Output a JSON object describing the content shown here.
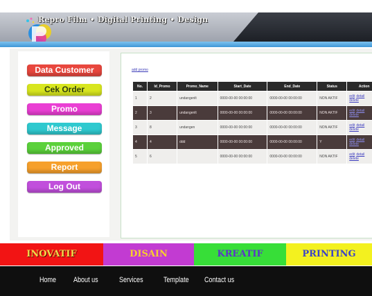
{
  "header": {
    "title": "Repro Film • Digital Printing • Design"
  },
  "sidebar": {
    "items": [
      {
        "label": "Data Customer"
      },
      {
        "label": "Cek Order"
      },
      {
        "label": "Promo"
      },
      {
        "label": "Message"
      },
      {
        "label": "Approved"
      },
      {
        "label": "Report"
      },
      {
        "label": "Log Out"
      }
    ]
  },
  "main": {
    "add_link": "add promo",
    "table": {
      "headers": [
        "No.",
        "Id_Promo",
        "Promo_Name",
        "Start_Date",
        "End_Date",
        "Status",
        "Action"
      ],
      "rows": [
        {
          "no": "1",
          "id": "2",
          "name": "undangenlt",
          "start": "0000-00-00 00:00:00",
          "end": "0000-00-00 00:00:00",
          "status": "NON AKTIF",
          "edit": "edit",
          "detail": "detail",
          "delete": "delete"
        },
        {
          "no": "2",
          "id": "3",
          "name": "undangenlt",
          "start": "0000-00-00 00:00:00",
          "end": "0000-00-00 00:00:00",
          "status": "NON AKTIF",
          "edit": "edit",
          "detail": "detail",
          "delete": "delete"
        },
        {
          "no": "3",
          "id": "8",
          "name": "undangen",
          "start": "0000-00-00 00:00:00",
          "end": "0000-00-00 00:00:00",
          "status": "NON AKTIF",
          "edit": "edit",
          "detail": "detail",
          "delete": "delete"
        },
        {
          "no": "4",
          "id": "4",
          "name": "ddd",
          "start": "0000-00-00 00:00:00",
          "end": "0000-00-00 00:00:00",
          "status": "Y",
          "edit": "edit",
          "detail": "detail",
          "delete": "delete"
        },
        {
          "no": "5",
          "id": "6",
          "name": "",
          "start": "0000-00-00 00:00:00",
          "end": "0000-00-00 00:00:00",
          "status": "NON AKTIF",
          "edit": "edit",
          "detail": "detail",
          "delete": "delete"
        }
      ]
    }
  },
  "categories": {
    "items": [
      {
        "label": "INOVATIF"
      },
      {
        "label": "DISAIN"
      },
      {
        "label": "KREATIF"
      },
      {
        "label": "PRINTING"
      }
    ]
  },
  "nav": {
    "items": [
      {
        "label": "Home"
      },
      {
        "label": "About us"
      },
      {
        "label": "Services"
      },
      {
        "label": "Template"
      },
      {
        "label": "Contact us"
      }
    ]
  },
  "colors": {
    "accent_blue": "#3f97d6",
    "header_dark": "#1d2026"
  },
  "icons": {
    "logo": "repro-logo-icon"
  }
}
